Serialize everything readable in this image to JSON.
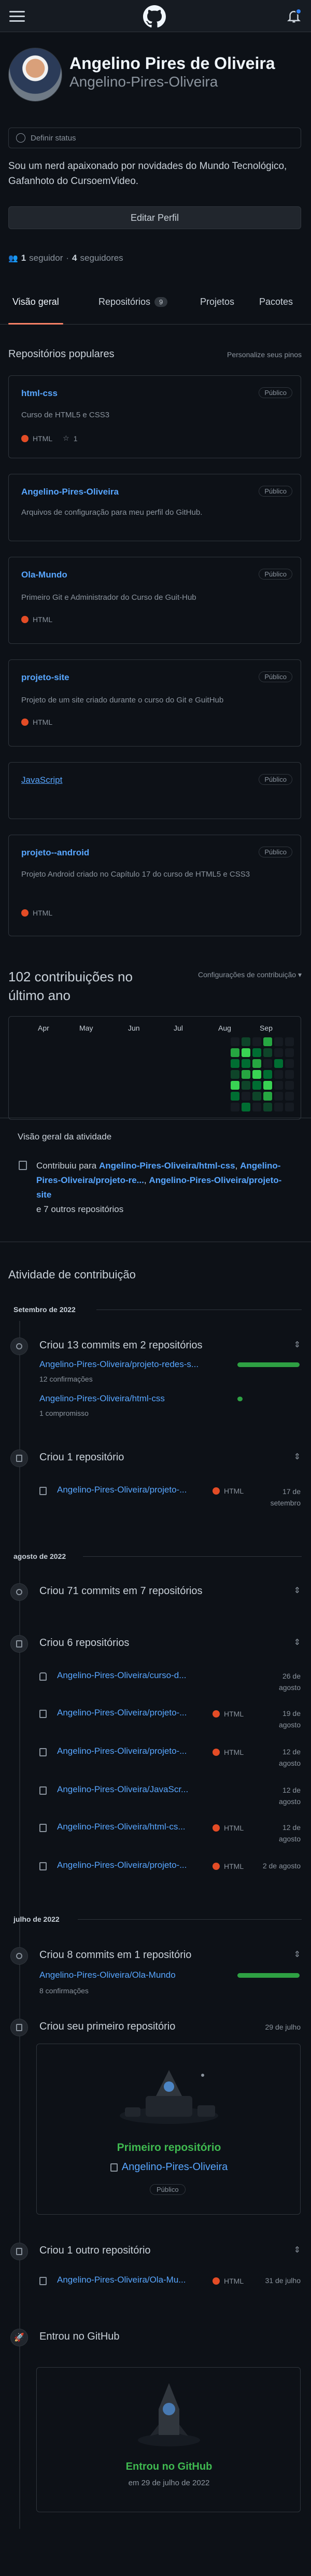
{
  "profile": {
    "name": "Angelino Pires de Oliveira",
    "username": "Angelino-Pires-Oliveira",
    "status_label": "Definir status",
    "bio": "Sou um nerd apaixonado por novidades do Mundo Tecnológico, Gafanhoto do CursoemVideo.",
    "edit_button": "Editar Perfil",
    "followers_count": "1",
    "followers_label": "seguidor",
    "following_count": "4",
    "following_label": "seguidores"
  },
  "tabs": [
    {
      "label": "Visão geral"
    },
    {
      "label": "Repositórios",
      "count": "9"
    },
    {
      "label": "Projetos"
    },
    {
      "label": "Pacotes"
    }
  ],
  "popular": {
    "title": "Repositórios populares",
    "customize": "Personalize seus pinos",
    "repos": [
      {
        "name": "html-css",
        "badge": "Público",
        "desc": "Curso de HTML5 e CSS3",
        "lang": "HTML",
        "stars": "1"
      },
      {
        "name": "Angelino-Pires-Oliveira",
        "badge": "Público",
        "desc": "Arquivos de configuração para meu perfil do GitHub."
      },
      {
        "name": "Ola-Mundo",
        "badge": "Público",
        "desc": "Primeiro Git e Administrador do Curso de Guit-Hub",
        "lang": "HTML"
      },
      {
        "name": "projeto-site",
        "badge": "Público",
        "desc": "Projeto de um site criado durante o curso do Git e GuitHub",
        "lang": "HTML"
      },
      {
        "name": "JavaScript",
        "badge": "Público"
      },
      {
        "name": "projeto--android",
        "badge": "Público",
        "desc": "Projeto Android criado no Capítulo 17 do curso de HTML5 e CSS3",
        "lang": "HTML"
      }
    ]
  },
  "contrib": {
    "title": "102 contribuições no último ano",
    "settings": "Configurações de contribuição",
    "months": [
      "Apr",
      "May",
      "Jun",
      "Jul",
      "Aug",
      "Sep"
    ]
  },
  "overview": {
    "title": "Visão geral da atividade",
    "prefix": "Contribuiu para",
    "repo1": "Angelino-Pires-Oliveira/html-css",
    "repo2": "Angelino-Pires-Oliveira/projeto-re...",
    "repo3": "Angelino-Pires-Oliveira/projeto-site",
    "suffix": "e 7 outros repositórios"
  },
  "activity": {
    "title": "Atividade de contribuição",
    "sep_label": "Setembro de 2022",
    "sep_commits": "Criou 13 commits em 2 repositórios",
    "sep_repo1": "Angelino-Pires-Oliveira/projeto-redes-s...",
    "sep_repo1_sub": "12 confirmações",
    "sep_repo2": "Angelino-Pires-Oliveira/html-css",
    "sep_repo2_sub": "1 compromisso",
    "sep_created": "Criou 1 repositório",
    "sep_created_repo": "Angelino-Pires-Oliveira/projeto-...",
    "sep_created_lang": "HTML",
    "sep_created_date": "17 de setembro",
    "aug_label": "agosto de 2022",
    "aug_commits": "Criou 71 commits em 7 repositórios",
    "aug_created": "Criou 6 repositórios",
    "aug_repos": [
      {
        "name": "Angelino-Pires-Oliveira/curso-d...",
        "lang": "",
        "date": "26 de agosto"
      },
      {
        "name": "Angelino-Pires-Oliveira/projeto-...",
        "lang": "HTML",
        "date": "19 de agosto"
      },
      {
        "name": "Angelino-Pires-Oliveira/projeto-...",
        "lang": "HTML",
        "date": "12 de agosto"
      },
      {
        "name": "Angelino-Pires-Oliveira/JavaScr...",
        "lang": "",
        "date": "12 de agosto"
      },
      {
        "name": "Angelino-Pires-Oliveira/html-cs...",
        "lang": "HTML",
        "date": "12 de agosto"
      },
      {
        "name": "Angelino-Pires-Oliveira/projeto-...",
        "lang": "HTML",
        "date": "2 de agosto"
      }
    ],
    "jul_label": "julho de 2022",
    "jul_commits": "Criou 8 commits em 1 repositório",
    "jul_repo": "Angelino-Pires-Oliveira/Ola-Mundo",
    "jul_repo_sub": "8 confirmações",
    "jul_first": "Criou seu primeiro repositório",
    "jul_first_date": "29 de julho",
    "first_repo_label": "Primeiro repositório",
    "first_repo_name": "Angelino-Pires-Oliveira",
    "first_repo_badge": "Público",
    "jul_other": "Criou 1 outro repositório",
    "jul_other_repo": "Angelino-Pires-Oliveira/Ola-Mu...",
    "jul_other_lang": "HTML",
    "jul_other_date": "31 de julho",
    "joined": "Entrou no GitHub",
    "joined_title": "Entrou no GitHub",
    "joined_date": "em 29 de julho de 2022"
  }
}
